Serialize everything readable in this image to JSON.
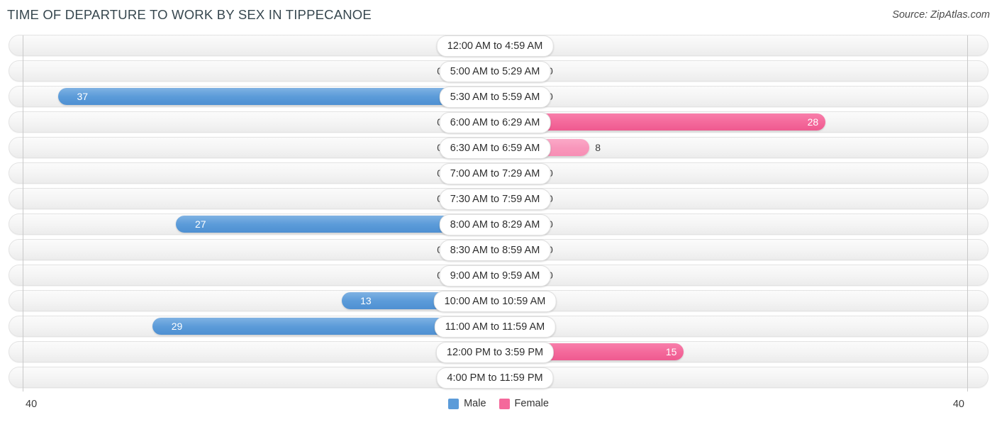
{
  "header": {
    "title": "TIME OF DEPARTURE TO WORK BY SEX IN TIPPECANOE",
    "source": "Source: ZipAtlas.com"
  },
  "legend": {
    "male_label": "Male",
    "female_label": "Female",
    "male_color": "#5b9bd9",
    "female_color": "#f4699b"
  },
  "axis": {
    "left_max": "40",
    "right_max": "40"
  },
  "chart_data": {
    "type": "bar",
    "title": "TIME OF DEPARTURE TO WORK BY SEX IN TIPPECANOE",
    "orientation": "horizontal-diverging",
    "xlabel": "",
    "ylabel": "",
    "xlim": [
      40,
      40
    ],
    "grid": false,
    "legend_position": "bottom-center",
    "categories": [
      "12:00 AM to 4:59 AM",
      "5:00 AM to 5:29 AM",
      "5:30 AM to 5:59 AM",
      "6:00 AM to 6:29 AM",
      "6:30 AM to 6:59 AM",
      "7:00 AM to 7:29 AM",
      "7:30 AM to 7:59 AM",
      "8:00 AM to 8:29 AM",
      "8:30 AM to 8:59 AM",
      "9:00 AM to 9:59 AM",
      "10:00 AM to 10:59 AM",
      "11:00 AM to 11:59 AM",
      "12:00 PM to 3:59 PM",
      "4:00 PM to 11:59 PM"
    ],
    "series": [
      {
        "name": "Male",
        "values": [
          0,
          0,
          37,
          0,
          0,
          0,
          0,
          27,
          0,
          0,
          13,
          29,
          0,
          0
        ]
      },
      {
        "name": "Female",
        "values": [
          0,
          0,
          0,
          28,
          8,
          0,
          0,
          0,
          0,
          0,
          0,
          0,
          15,
          0
        ]
      }
    ]
  },
  "rows": [
    {
      "label": "12:00 AM to 4:59 AM",
      "male": "0",
      "male_value": 0,
      "male_pct": 0,
      "male_zero": true,
      "female": "0",
      "female_value": 0,
      "female_pct": 0,
      "female_zero": true
    },
    {
      "label": "5:00 AM to 5:29 AM",
      "male": "0",
      "male_value": 0,
      "male_pct": 0,
      "male_zero": true,
      "female": "0",
      "female_value": 0,
      "female_pct": 0,
      "female_zero": true
    },
    {
      "label": "5:30 AM to 5:59 AM",
      "male": "37",
      "male_value": 37,
      "male_pct": 92.5,
      "male_zero": false,
      "female": "0",
      "female_value": 0,
      "female_pct": 0,
      "female_zero": true
    },
    {
      "label": "6:00 AM to 6:29 AM",
      "male": "0",
      "male_value": 0,
      "male_pct": 0,
      "male_zero": true,
      "female": "28",
      "female_value": 28,
      "female_pct": 70,
      "female_zero": false
    },
    {
      "label": "6:30 AM to 6:59 AM",
      "male": "0",
      "male_value": 0,
      "male_pct": 0,
      "male_zero": true,
      "female": "8",
      "female_value": 8,
      "female_pct": 20,
      "female_zero": false
    },
    {
      "label": "7:00 AM to 7:29 AM",
      "male": "0",
      "male_value": 0,
      "male_pct": 0,
      "male_zero": true,
      "female": "0",
      "female_value": 0,
      "female_pct": 0,
      "female_zero": true
    },
    {
      "label": "7:30 AM to 7:59 AM",
      "male": "0",
      "male_value": 0,
      "male_pct": 0,
      "male_zero": true,
      "female": "0",
      "female_value": 0,
      "female_pct": 0,
      "female_zero": true
    },
    {
      "label": "8:00 AM to 8:29 AM",
      "male": "27",
      "male_value": 27,
      "male_pct": 67.5,
      "male_zero": false,
      "female": "0",
      "female_value": 0,
      "female_pct": 0,
      "female_zero": true
    },
    {
      "label": "8:30 AM to 8:59 AM",
      "male": "0",
      "male_value": 0,
      "male_pct": 0,
      "male_zero": true,
      "female": "0",
      "female_value": 0,
      "female_pct": 0,
      "female_zero": true
    },
    {
      "label": "9:00 AM to 9:59 AM",
      "male": "0",
      "male_value": 0,
      "male_pct": 0,
      "male_zero": true,
      "female": "0",
      "female_value": 0,
      "female_pct": 0,
      "female_zero": true
    },
    {
      "label": "10:00 AM to 10:59 AM",
      "male": "13",
      "male_value": 13,
      "male_pct": 32.5,
      "male_zero": false,
      "female": "0",
      "female_value": 0,
      "female_pct": 0,
      "female_zero": true
    },
    {
      "label": "11:00 AM to 11:59 AM",
      "male": "29",
      "male_value": 29,
      "male_pct": 72.5,
      "male_zero": false,
      "female": "0",
      "female_value": 0,
      "female_pct": 0,
      "female_zero": true
    },
    {
      "label": "12:00 PM to 3:59 PM",
      "male": "0",
      "male_value": 0,
      "male_pct": 0,
      "male_zero": true,
      "female": "15",
      "female_value": 15,
      "female_pct": 40,
      "female_zero": false
    },
    {
      "label": "4:00 PM to 11:59 PM",
      "male": "0",
      "male_value": 0,
      "male_pct": 0,
      "male_zero": true,
      "female": "0",
      "female_value": 0,
      "female_pct": 0,
      "female_zero": true
    }
  ]
}
